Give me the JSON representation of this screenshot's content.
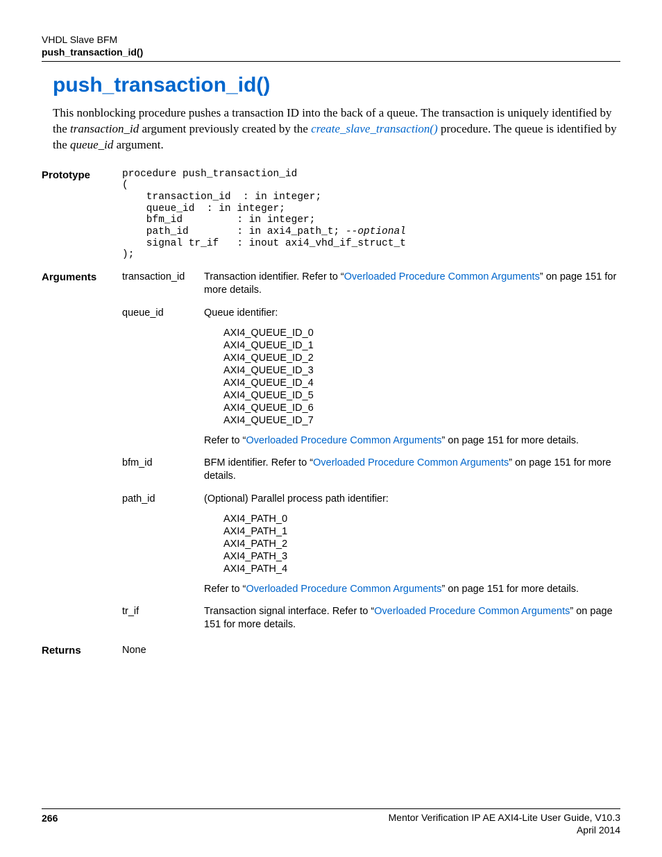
{
  "header": {
    "section": "VHDL Slave BFM",
    "subsection": "push_transaction_id()"
  },
  "title": "push_transaction_id()",
  "intro": {
    "part1": "This nonblocking procedure pushes a transaction ID into the back of a queue. The transaction is uniquely identified by the ",
    "ital1": "transaction_id",
    "part2": " argument previously created by the ",
    "link": "create_slave_transaction()",
    "part3": " procedure. The queue is identified by the ",
    "ital2": "queue_id",
    "part4": " argument."
  },
  "labels": {
    "prototype": "Prototype",
    "arguments": "Arguments",
    "returns": "Returns"
  },
  "prototype": {
    "l1": "procedure push_transaction_id",
    "l2": "(",
    "l3": "    transaction_id  : in integer;",
    "l4": "    queue_id  : in integer;",
    "l5": "    bfm_id         : in integer;",
    "l6a": "    path_id        : in axi4_path_t; ",
    "l6b": "--optional",
    "l7": "    signal tr_if   : inout axi4_vhd_if_struct_t",
    "l8": ");"
  },
  "args": {
    "transaction_id": {
      "name": "transaction_id",
      "pre": "Transaction identifier. Refer to “",
      "link": "Overloaded Procedure Common Arguments",
      "post": "” on page 151 for more details."
    },
    "queue_id": {
      "name": "queue_id",
      "intro": "Queue identifier:",
      "e0": "AXI4_QUEUE_ID_0",
      "e1": "AXI4_QUEUE_ID_1",
      "e2": "AXI4_QUEUE_ID_2",
      "e3": "AXI4_QUEUE_ID_3",
      "e4": "AXI4_QUEUE_ID_4",
      "e5": "AXI4_QUEUE_ID_5",
      "e6": "AXI4_QUEUE_ID_6",
      "e7": "AXI4_QUEUE_ID_7",
      "ref_pre": "Refer to “",
      "ref_link": "Overloaded Procedure Common Arguments",
      "ref_post": "” on page 151 for more details."
    },
    "bfm_id": {
      "name": "bfm_id",
      "pre": "BFM identifier. Refer to “",
      "link": "Overloaded Procedure Common Arguments",
      "post": "” on page 151 for more details."
    },
    "path_id": {
      "name": "path_id",
      "intro": "(Optional) Parallel process path identifier:",
      "e0": "AXI4_PATH_0",
      "e1": "AXI4_PATH_1",
      "e2": "AXI4_PATH_2",
      "e3": "AXI4_PATH_3",
      "e4": "AXI4_PATH_4",
      "ref_pre": "Refer to “",
      "ref_link": "Overloaded Procedure Common Arguments",
      "ref_post": "” on page 151 for more details."
    },
    "tr_if": {
      "name": "tr_if",
      "pre": "Transaction signal interface. Refer to “",
      "link": "Overloaded Procedure Common Arguments",
      "post": "” on page 151 for more details."
    }
  },
  "returns": "None",
  "footer": {
    "page": "266",
    "guide": "Mentor Verification IP AE AXI4-Lite User Guide, V10.3",
    "date": "April 2014"
  }
}
